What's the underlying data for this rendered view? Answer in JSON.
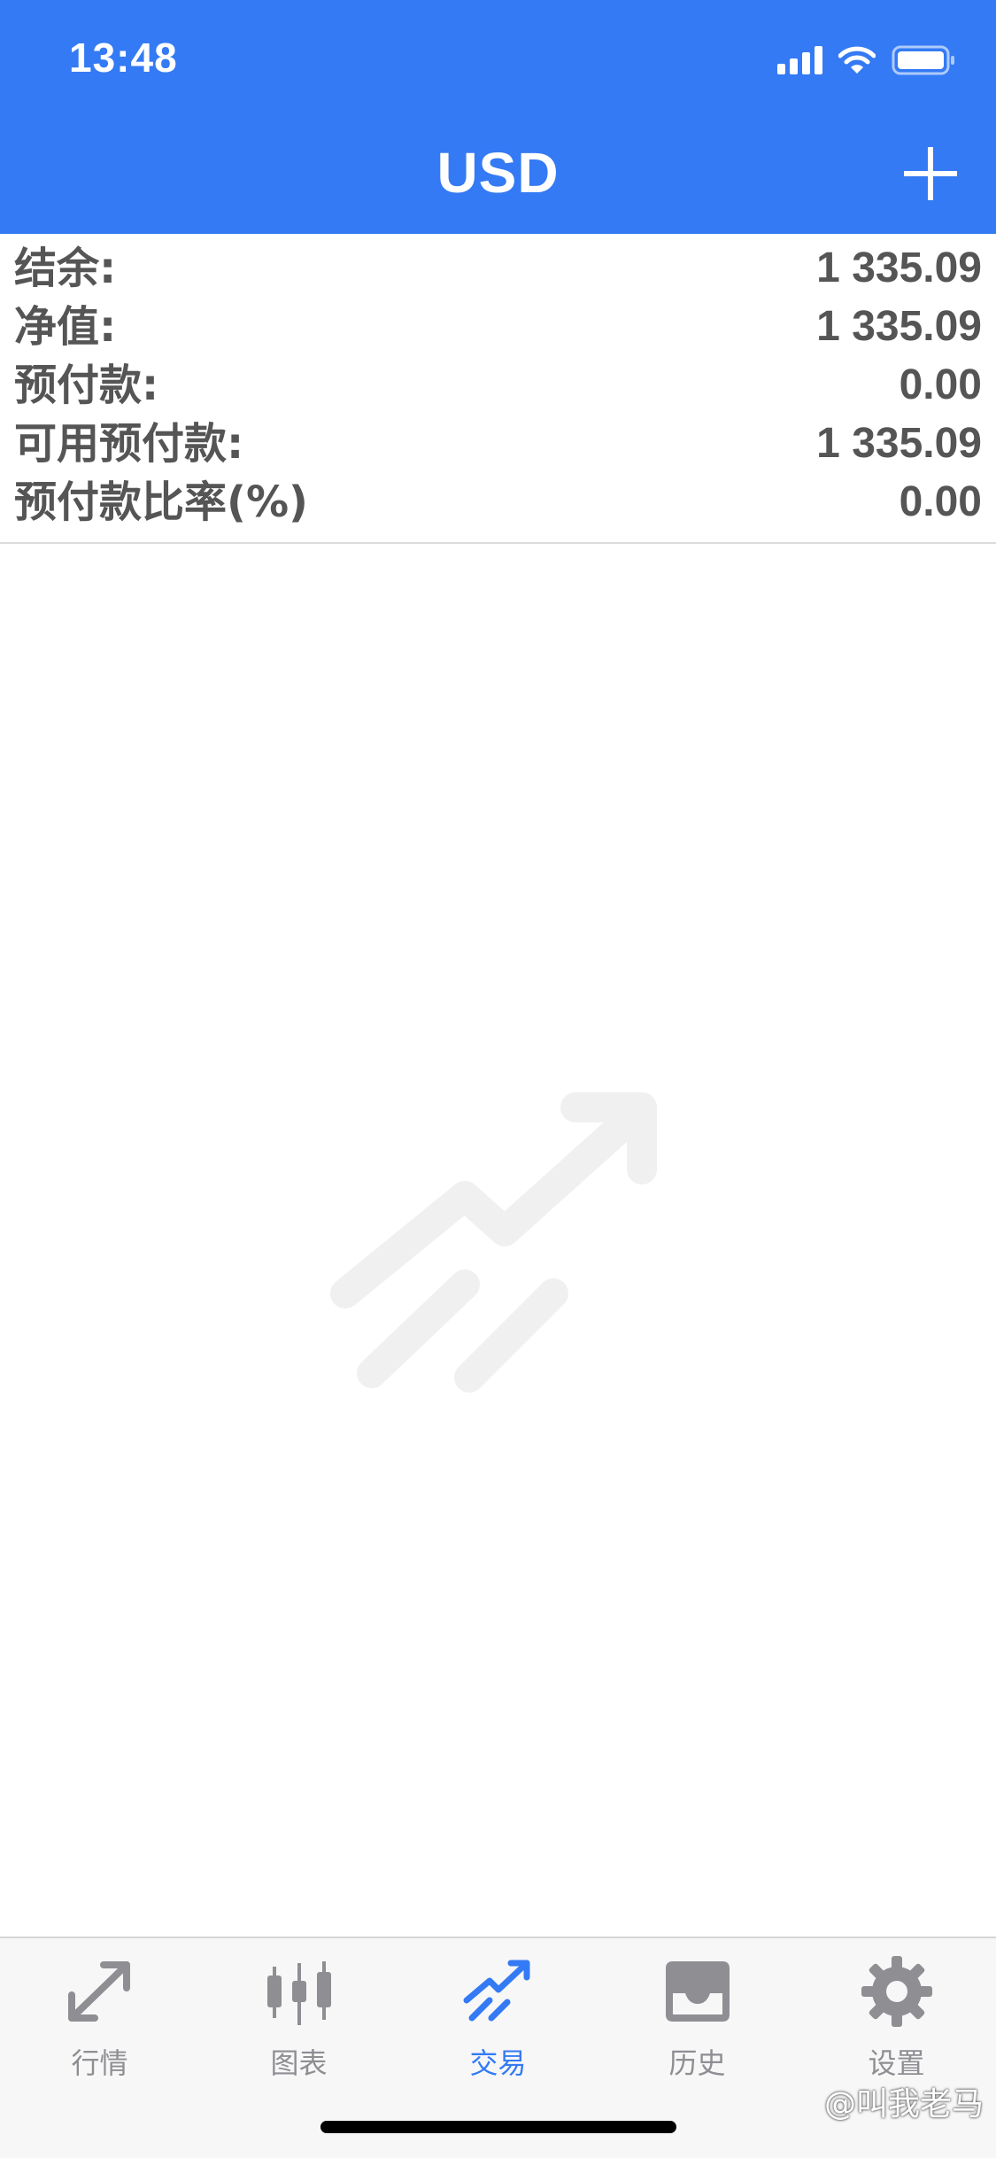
{
  "status_bar": {
    "time": "13:48",
    "icons": [
      "signal-icon",
      "wifi-icon",
      "battery-icon"
    ]
  },
  "nav": {
    "title": "USD",
    "add_icon": "plus-icon"
  },
  "summary": [
    {
      "label": "结余:",
      "value": "1 335.09"
    },
    {
      "label": "净值:",
      "value": "1 335.09"
    },
    {
      "label": "预付款:",
      "value": "0.00"
    },
    {
      "label": "可用预付款:",
      "value": "1 335.09"
    },
    {
      "label": "预付款比率(%)",
      "value": "0.00"
    }
  ],
  "empty_state": {
    "icon": "trade-chart-icon"
  },
  "tabs": [
    {
      "label": "行情",
      "icon": "quotes-icon",
      "active": false
    },
    {
      "label": "图表",
      "icon": "candlestick-icon",
      "active": false
    },
    {
      "label": "交易",
      "icon": "trade-icon",
      "active": true
    },
    {
      "label": "历史",
      "icon": "inbox-icon",
      "active": false
    },
    {
      "label": "设置",
      "icon": "gear-icon",
      "active": false
    }
  ],
  "watermark": "@叫我老马",
  "colors": {
    "accent": "#347af4",
    "text_dark": "#555555",
    "tab_inactive": "#8e8e93",
    "tab_bar_bg": "#f7f7f7"
  }
}
